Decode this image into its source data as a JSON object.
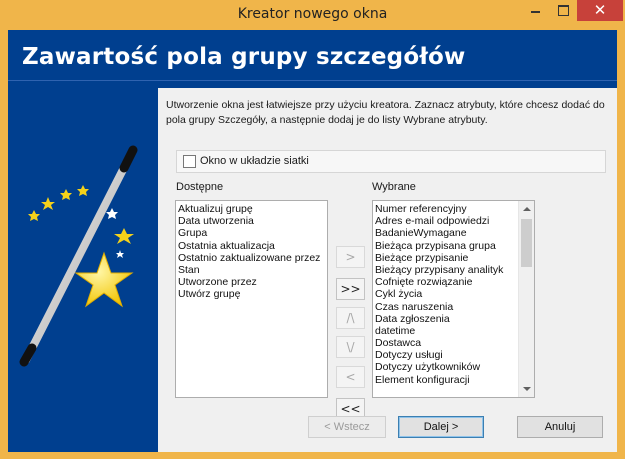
{
  "window": {
    "title": "Kreator nowego okna",
    "close_glyph": "✕"
  },
  "header": {
    "title": "Zawartość pola grupy szczegółów"
  },
  "intro": {
    "text": "Utworzenie okna jest łatwiejsze przy użyciu kreatora. Zaznacz atrybuty, które chcesz dodać do pola grupy Szczegóły, a następnie dodaj je do listy Wybrane atrybuty."
  },
  "grid_option": {
    "label": "Okno w układzie siatki",
    "checked": false
  },
  "available": {
    "label": "Dostępne",
    "items": [
      "Aktualizuj grupę",
      "Data utworzenia",
      "Grupa",
      "Ostatnia aktualizacja",
      "Ostatnio zaktualizowane przez",
      "Stan",
      "Utworzone przez",
      "Utwórz grupę"
    ]
  },
  "selected": {
    "label": "Wybrane",
    "items": [
      "Numer referencyjny",
      "Adres e-mail odpowiedzi",
      "BadanieWymagane",
      "Bieżąca przypisana grupa",
      "Bieżące przypisanie",
      "Bieżący przypisany analityk",
      "Cofnięte rozwiązanie",
      "Cykl życia",
      "Czas naruszenia",
      "Data zgłoszenia",
      "datetime",
      "Dostawca",
      "Dotyczy usługi",
      "Dotyczy użytkowników",
      "Element konfiguracji"
    ]
  },
  "move_buttons": {
    "add": ">",
    "add_all": ">>",
    "move_up": "/\\",
    "move_down": "\\/",
    "remove": "<",
    "remove_all": "<<"
  },
  "footer": {
    "back": "< Wstecz",
    "next": "Dalej >",
    "cancel": "Anuluj"
  },
  "colors": {
    "title_bar": "#f0b54a",
    "header_bg": "#003f8f",
    "close_button": "#c7413a",
    "panel_bg": "#f0f0f0"
  },
  "icons": {
    "wizard": "magic-wand-with-stars-icon"
  }
}
